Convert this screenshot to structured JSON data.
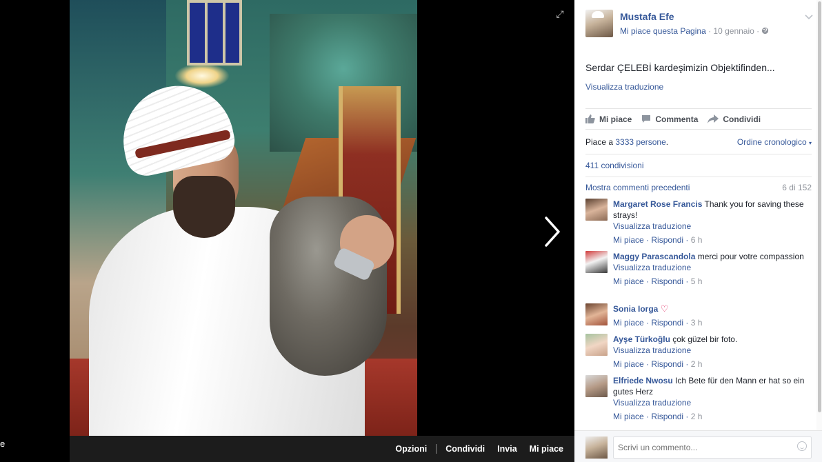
{
  "viewer": {
    "left_edge_text": "e",
    "bottom_bar": {
      "options_label": "Opzioni",
      "share_label": "Condividi",
      "send_label": "Invia",
      "like_label": "Mi piace"
    }
  },
  "post": {
    "author": "Mustafa Efe",
    "like_page_label": "Mi piace questa Pagina",
    "separator": " · ",
    "date": "10 gennaio",
    "audience_icon": "globe-icon",
    "text": "Serdar ÇELEBİ kardeşimizin Objektifinden...",
    "translate_label": "Visualizza traduzione",
    "actions": {
      "like_label": "Mi piace",
      "comment_label": "Commenta",
      "share_label": "Condividi"
    },
    "likes_prefix": "Piace a ",
    "likes_link": "3333 persone",
    "likes_suffix": ".",
    "order_label": "Ordine cronologico",
    "shares_label": "411 condivisioni",
    "prev_comments_label": "Mostra commenti precedenti",
    "comments_count": "6 di 152"
  },
  "comments": [
    {
      "name": "Margaret Rose Francis",
      "text": "Thank you for saving these strays!",
      "translate": "Visualizza traduzione",
      "like": "Mi piace",
      "reply": "Rispondi",
      "time": "6 h"
    },
    {
      "name": "Maggy Parascandola",
      "text": "merci pour votre compassion",
      "translate": "Visualizza traduzione",
      "like": "Mi piace",
      "reply": "Rispondi",
      "time": "5 h"
    },
    {
      "name": "Sonia Iorga",
      "text": "",
      "like": "Mi piace",
      "reply": "Rispondi",
      "time": "3 h"
    },
    {
      "name": "Ayşe Türkoğlu",
      "text": "çok güzel bir foto.",
      "translate": "Visualizza traduzione",
      "like": "Mi piace",
      "reply": "Rispondi",
      "time": "2 h"
    },
    {
      "name": "Elfriede Nwosu",
      "text": "Ich Bete für den Mann er hat so ein gutes Herz",
      "translate": "Visualizza traduzione",
      "like": "Mi piace",
      "reply": "Rispondi",
      "time": "2 h"
    }
  ],
  "composer": {
    "placeholder": "Scrivi un commento..."
  },
  "colors": {
    "link": "#365899",
    "muted": "#90949c",
    "text": "#1d2129"
  }
}
